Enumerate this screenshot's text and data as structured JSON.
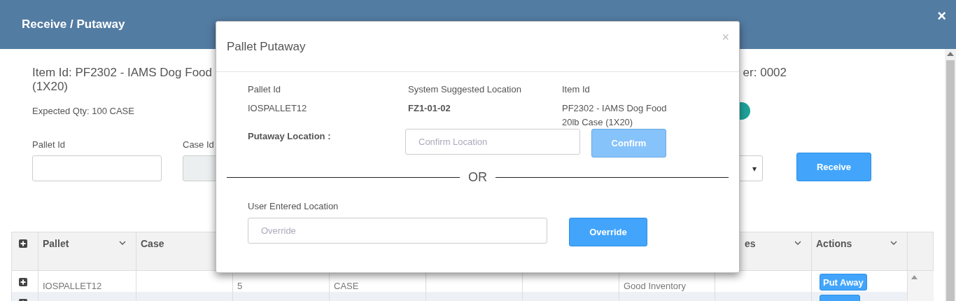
{
  "page": {
    "title": "Receive / Putaway",
    "close": "×"
  },
  "item": {
    "heading_lines": [
      "Item Id: PF2302 - IAMS Dog Food",
      "(1X20)"
    ],
    "heading_right": "er: 0002",
    "expected_qty": "Expected Qty: 100 CASE"
  },
  "form": {
    "fields": [
      {
        "label": "Pallet Id",
        "disabled": false
      },
      {
        "label": "Case Id",
        "disabled": true
      }
    ],
    "select_caret": "▾",
    "button": "Receive"
  },
  "table": {
    "columns": [
      {
        "label": "Pallet"
      },
      {
        "label": "Case"
      },
      {},
      {},
      {},
      {},
      {},
      {
        "label": "es"
      },
      {
        "label": "Actions"
      }
    ],
    "rows": [
      {
        "cells": [
          "IOSPALLET12",
          null,
          "5",
          "CASE",
          null,
          null,
          "Good Inventory",
          null
        ],
        "action": "Put Away"
      },
      {
        "cells": []
      }
    ]
  },
  "modal": {
    "title": "Pallet Putaway",
    "close": "×",
    "info": [
      {
        "label": "Pallet Id",
        "value": "IOSPALLET12",
        "emphasized": false
      },
      {
        "label": "System Suggested Location",
        "value": "FZ1-01-02",
        "emphasized": true
      },
      {
        "label": "Item Id",
        "value": "PF2302 - IAMS Dog Food 20lb Case (1X20)",
        "emphasized": false
      }
    ],
    "confirm": {
      "label": "Putaway Location :",
      "placeholder": "Confirm Location",
      "button": "Confirm",
      "disabled": true
    },
    "divider_text": "OR",
    "override": {
      "label": "User Entered Location",
      "placeholder": "Override",
      "button": "Override"
    }
  }
}
